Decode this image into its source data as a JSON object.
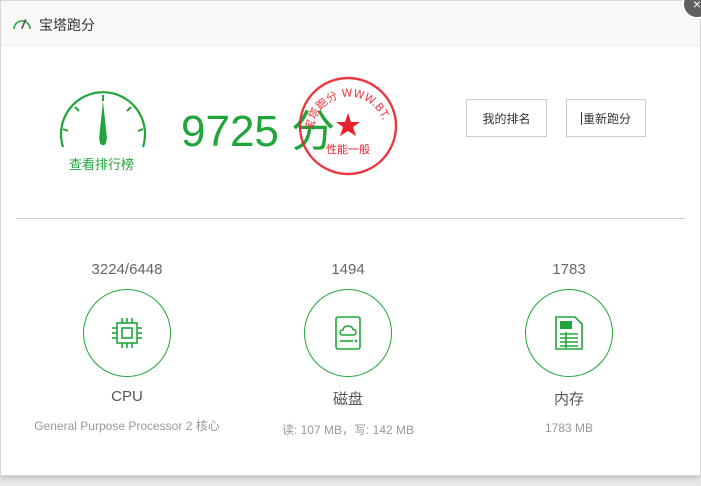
{
  "dialog": {
    "title": "宝塔跑分",
    "close_label": "×"
  },
  "score": {
    "value": "9725 分",
    "rank_link": "查看排行榜"
  },
  "seal": {
    "top_text": "宝塔跑分 WWW.BT.CN",
    "bottom_text": "性能一般"
  },
  "actions": {
    "my_rank": "我的排名",
    "retest": "重新跑分"
  },
  "metrics": {
    "cpu": {
      "value": "3224/6448",
      "name": "CPU",
      "desc": "General Purpose Processor 2 核心"
    },
    "disk": {
      "value": "1494",
      "name": "磁盘",
      "desc": "读: 107 MB，写: 142 MB"
    },
    "mem": {
      "value": "1783",
      "name": "内存",
      "desc": "1783 MB"
    }
  },
  "colors": {
    "accent": "#20a53a",
    "seal": "#e8222c"
  }
}
